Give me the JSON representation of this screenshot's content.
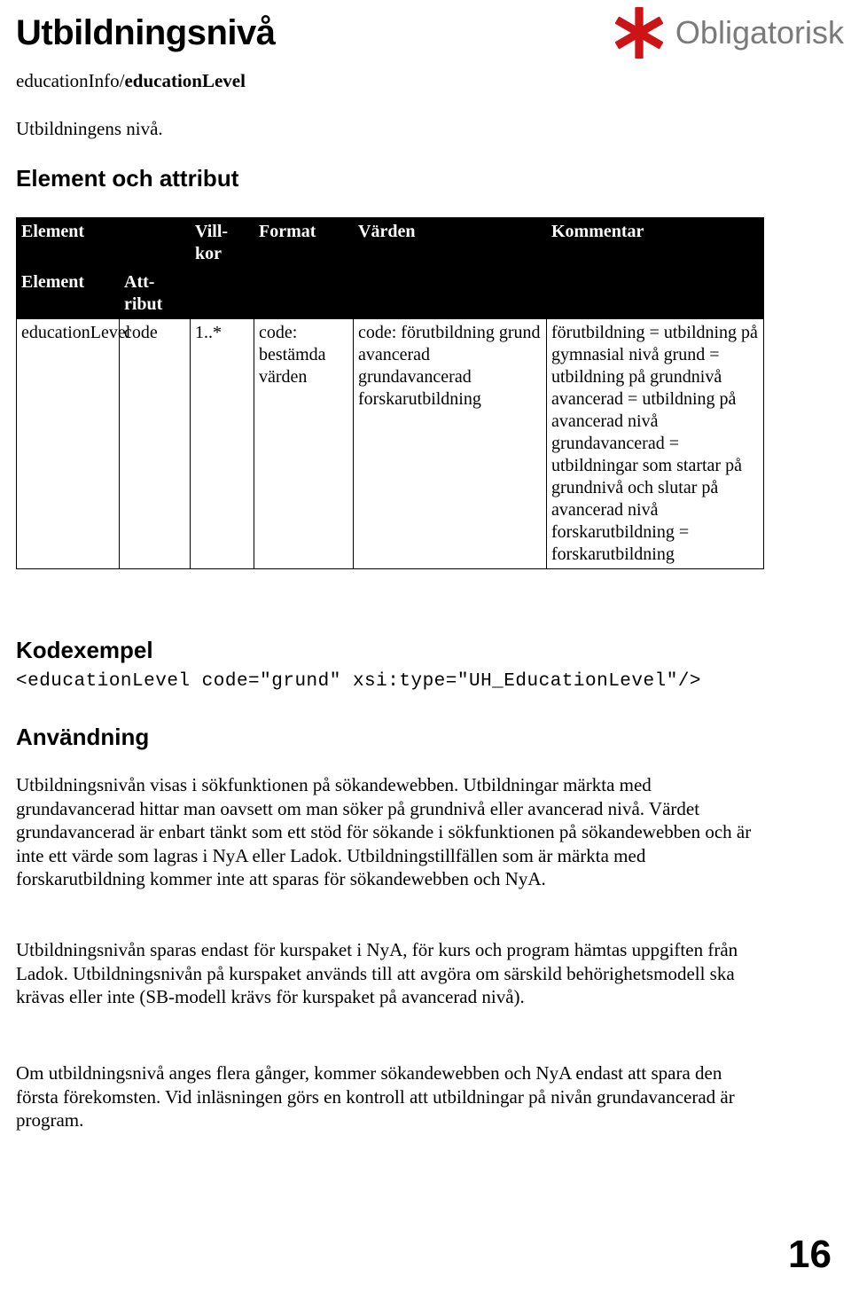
{
  "document": {
    "title": "Utbildningsnivå",
    "breadcrumb_prefix": "educationInfo/",
    "breadcrumb_bold": "educationLevel",
    "intro": "Utbildningens nivå.",
    "page_number": "16"
  },
  "logo": {
    "icon": "red-asterisk-icon",
    "label": "Obligatorisk",
    "mark_color": "#cc1417",
    "text_color": "#7a7a7a"
  },
  "sections": {
    "element_attribut": "Element och attribut",
    "kodexempel": "Kodexempel",
    "anvandning": "Användning"
  },
  "table": {
    "headers": {
      "element_group": "Element",
      "element_sub": "Element",
      "attribut_sub": "Att-ribut",
      "villkor": "Vill-kor",
      "format": "Format",
      "varden": "Värden",
      "kommentar": "Kommentar"
    },
    "rows": [
      {
        "element": "educationLevel",
        "attribut": "code",
        "villkor": "1..*",
        "format": "code: bestämda värden",
        "varden": "code: förutbildning grund avancerad grundavancerad forskarutbildning",
        "kommentar": "förutbildning = utbildning på gymnasial nivå grund = utbildning på grundnivå avancerad = utbildning på avancerad nivå grundavancerad = utbildningar som startar på grundnivå och slutar på avancerad nivå forskarutbildning = forskarutbildning"
      }
    ]
  },
  "code_example": "<educationLevel code=\"grund\" xsi:type=\"UH_EducationLevel\"/>",
  "usage": {
    "paragraph_1": "Utbildningsnivån visas i sökfunktionen på sökandewebben. Utbildningar märkta med grundavancerad hittar man oavsett om man söker på grundnivå eller avancerad nivå. Värdet grundavancerad är enbart tänkt som ett stöd för sökande i sökfunktionen på sökandewebben och är inte ett värde som lagras i NyA eller Ladok. Utbildningstillfällen som är märkta med forskarutbildning kommer inte att sparas för sökandewebben och NyA.",
    "paragraph_2": "Utbildningsnivån sparas endast för kurspaket i NyA, för kurs och program hämtas uppgiften från Ladok. Utbildningsnivån på kurspaket används till att avgöra om särskild behörighetsmodell ska krävas eller inte (SB-modell krävs för kurspaket på avancerad nivå).",
    "paragraph_3": "Om utbildningsnivå anges flera gånger, kommer sökandewebben och NyA endast att spara den första förekomsten. Vid inläsningen görs en kontroll att utbildningar på nivån grundavancerad är program."
  }
}
